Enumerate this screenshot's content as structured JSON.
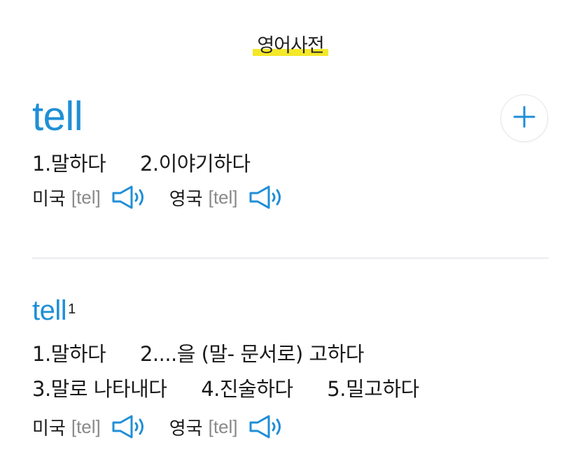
{
  "header": {
    "title": "영어사전"
  },
  "entries": [
    {
      "word": "tell",
      "superscript": "",
      "meanings_line1": [
        "1.말하다",
        "2.이야기하다"
      ],
      "meanings_line2": [],
      "pron": [
        {
          "region": "미국",
          "ipa": "[tel]"
        },
        {
          "region": "영국",
          "ipa": "[tel]"
        }
      ]
    },
    {
      "word": "tell",
      "superscript": "1",
      "meanings_line1": [
        "1.말하다",
        "2....을 (말- 문서로) 고하다"
      ],
      "meanings_line2": [
        "3.말로 나타내다",
        "4.진술하다",
        "5.밀고하다"
      ],
      "pron": [
        {
          "region": "미국",
          "ipa": "[tel]"
        },
        {
          "region": "영국",
          "ipa": "[tel]"
        }
      ]
    }
  ],
  "add_button": {
    "icon": "plus-icon"
  },
  "colors": {
    "accent": "#1f8fd6",
    "highlight": "#f4e82a",
    "divider": "#e9ecef"
  }
}
